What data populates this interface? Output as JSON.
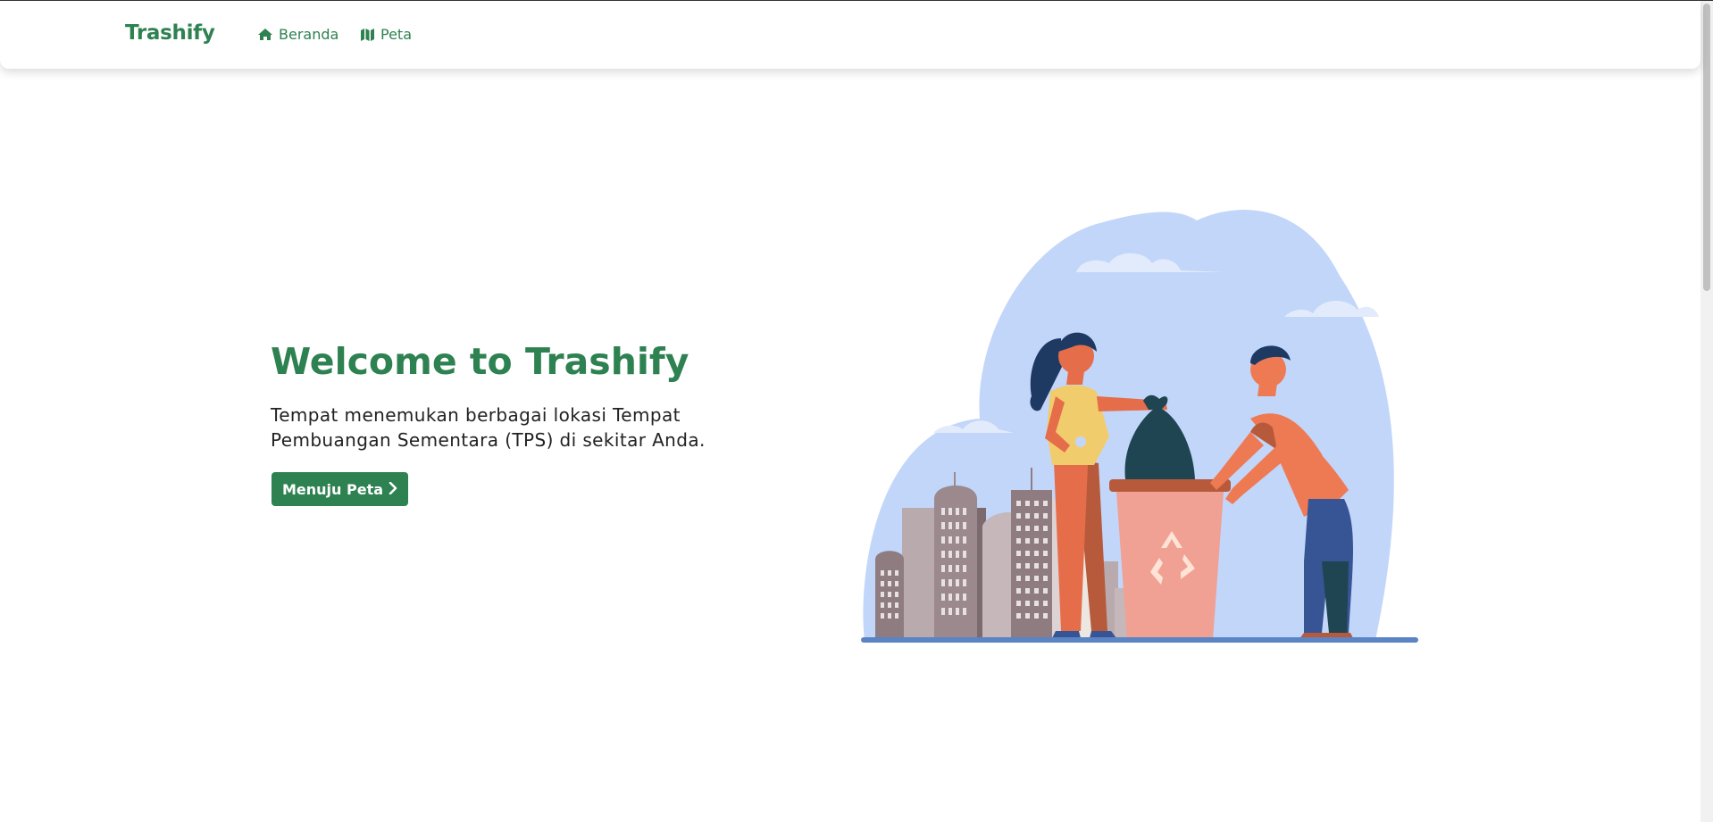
{
  "navbar": {
    "brand": "Trashify",
    "links": [
      {
        "label": "Beranda",
        "icon": "home-icon"
      },
      {
        "label": "Peta",
        "icon": "map-icon"
      }
    ]
  },
  "hero": {
    "title": "Welcome to Trashify",
    "description": "Tempat menemukan berbagai lokasi Tempat Pembuangan Sementara (TPS) di sekitar Anda.",
    "cta_label": "Menuju Peta",
    "cta_icon": "chevron-right-icon"
  },
  "colors": {
    "brand_green": "#2e8150",
    "sky_blue": "#c2d6fa",
    "trash_bin": "#f0a193"
  }
}
